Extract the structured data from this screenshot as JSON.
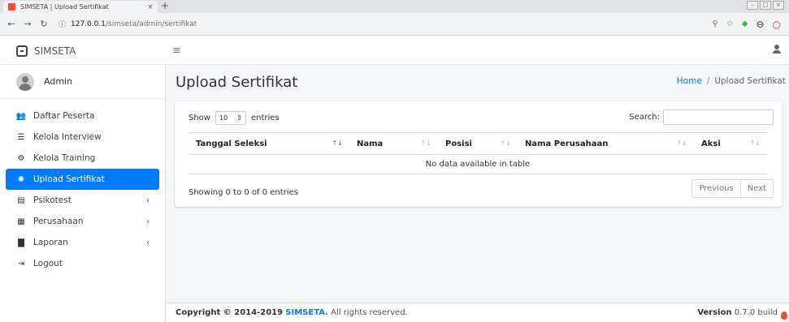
{
  "browser": {
    "tab_title": "SIMSETA | Upload Sertifikat",
    "tab_close": "×",
    "new_tab": "+",
    "url_host": "127.0.0.1",
    "url_path": "/simseta/admin/sertifikat",
    "icons": [
      "back-icon",
      "forward-icon",
      "reload-icon",
      "info-icon",
      "zoom-icon",
      "star-icon",
      "extension-icon",
      "account-icon",
      "opera-icon"
    ]
  },
  "header": {
    "brand": "SIMSETA",
    "menu_toggle_icon": "hamburger-icon",
    "user_icon": "user-icon"
  },
  "sidebar": {
    "user_name": "Admin",
    "items": [
      {
        "label": "Daftar Peserta",
        "icon": "users-icon",
        "active": false,
        "has_submenu": false
      },
      {
        "label": "Kelola Interview",
        "icon": "list-icon",
        "active": false,
        "has_submenu": false
      },
      {
        "label": "Kelola Training",
        "icon": "cogs-icon",
        "active": false,
        "has_submenu": false
      },
      {
        "label": "Upload Sertifikat",
        "icon": "certificate-icon",
        "active": true,
        "has_submenu": false
      },
      {
        "label": "Psikotest",
        "icon": "box-icon",
        "active": false,
        "has_submenu": true
      },
      {
        "label": "Perusahaan",
        "icon": "building-icon",
        "active": false,
        "has_submenu": true
      },
      {
        "label": "Laporan",
        "icon": "file-icon",
        "active": false,
        "has_submenu": true
      },
      {
        "label": "Logout",
        "icon": "logout-icon",
        "active": false,
        "has_submenu": false
      }
    ],
    "accent_color": "#007bff"
  },
  "main": {
    "title": "Upload Sertifikat",
    "breadcrumb": {
      "home": "Home",
      "separator": "/",
      "current": "Upload Sertifikat"
    },
    "table_controls": {
      "show_label": "Show",
      "entries_value": "10",
      "entries_label": "entries",
      "search_label": "Search:",
      "search_value": ""
    },
    "table": {
      "columns": [
        "Tanggal Seleksi",
        "Nama",
        "Posisi",
        "Nama Perusahaan",
        "Aksi"
      ],
      "empty_message": "No data available in table"
    },
    "info": "Showing 0 to 0 of 0 entries",
    "pagination": {
      "previous": "Previous",
      "next": "Next"
    }
  },
  "footer": {
    "copyright_prefix": "Copyright © 2014-2019",
    "brand": "SIMSETA.",
    "rights": "All rights reserved.",
    "version_label": "Version",
    "version_value": "0.7.0 build"
  }
}
